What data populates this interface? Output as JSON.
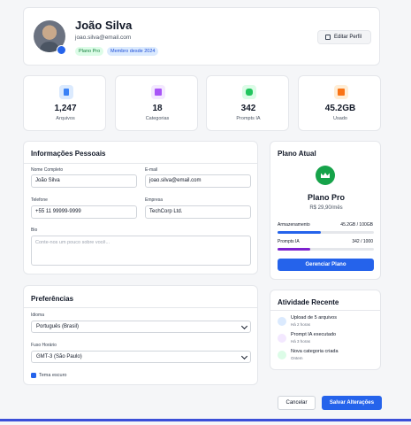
{
  "profile": {
    "name": "João Silva",
    "email": "joao.silva@email.com",
    "plan_badge": "Plano Pro",
    "member_badge": "Membro desde 2024",
    "edit_label": "Editar Perfil"
  },
  "stats": [
    {
      "value": "1,247",
      "label": "Arquivos",
      "icon": "file-icon",
      "color": "#3b82f6",
      "bg": "#dbeafe"
    },
    {
      "value": "18",
      "label": "Categorias",
      "icon": "folder-icon",
      "color": "#a855f7",
      "bg": "#f3e8ff"
    },
    {
      "value": "342",
      "label": "Prompts IA",
      "icon": "robot-icon",
      "color": "#22c55e",
      "bg": "#dcfce7"
    },
    {
      "value": "45.2GB",
      "label": "Usado",
      "icon": "storage-icon",
      "color": "#f97316",
      "bg": "#ffedd5"
    }
  ],
  "personal": {
    "title": "Informações Pessoais",
    "name_label": "Nome Completo",
    "name_value": "João Silva",
    "email_label": "E-mail",
    "email_value": "joao.silva@email.com",
    "phone_label": "Telefone",
    "phone_value": "+55 11 99999-9999",
    "company_label": "Empresa",
    "company_value": "TechCorp Ltd.",
    "bio_label": "Bio",
    "bio_placeholder": "Conte-nos um pouco sobre você..."
  },
  "preferences": {
    "title": "Preferências",
    "language_label": "Idioma",
    "language_value": "Português (Brasil)",
    "timezone_label": "Fuso Horário",
    "timezone_value": "GMT-3 (São Paulo)",
    "dark_theme_label": "Tema escuro",
    "dark_theme_checked": true
  },
  "plan": {
    "title": "Plano Atual",
    "name": "Plano Pro",
    "price": "R$ 29,90/mês",
    "storage_label": "Armazenamento",
    "storage_value": "45.2GB / 100GB",
    "storage_fraction": 0.452,
    "prompts_label": "Prompts IA",
    "prompts_value": "342 / 1000",
    "prompts_fraction": 0.342,
    "manage_label": "Gerenciar Plano"
  },
  "activity": {
    "title": "Atividade Recente",
    "items": [
      {
        "title": "Upload de 5 arquivos",
        "time": "Há 2 horas",
        "icon": "upload-icon",
        "color": "#3b82f6",
        "bg": "#dbeafe"
      },
      {
        "title": "Prompt IA executado",
        "time": "Há 3 horas",
        "icon": "sparkle-icon",
        "color": "#a855f7",
        "bg": "#f3e8ff"
      },
      {
        "title": "Nova categoria criada",
        "time": "Ontem",
        "icon": "folder-plus-icon",
        "color": "#22c55e",
        "bg": "#dcfce7"
      }
    ]
  },
  "actions": {
    "cancel_label": "Cancelar",
    "save_label": "Salvar Alterações"
  },
  "colors": {
    "accent": "#2563eb",
    "storage_bar": "#2563eb",
    "prompts_bar": "#7e22ce"
  }
}
